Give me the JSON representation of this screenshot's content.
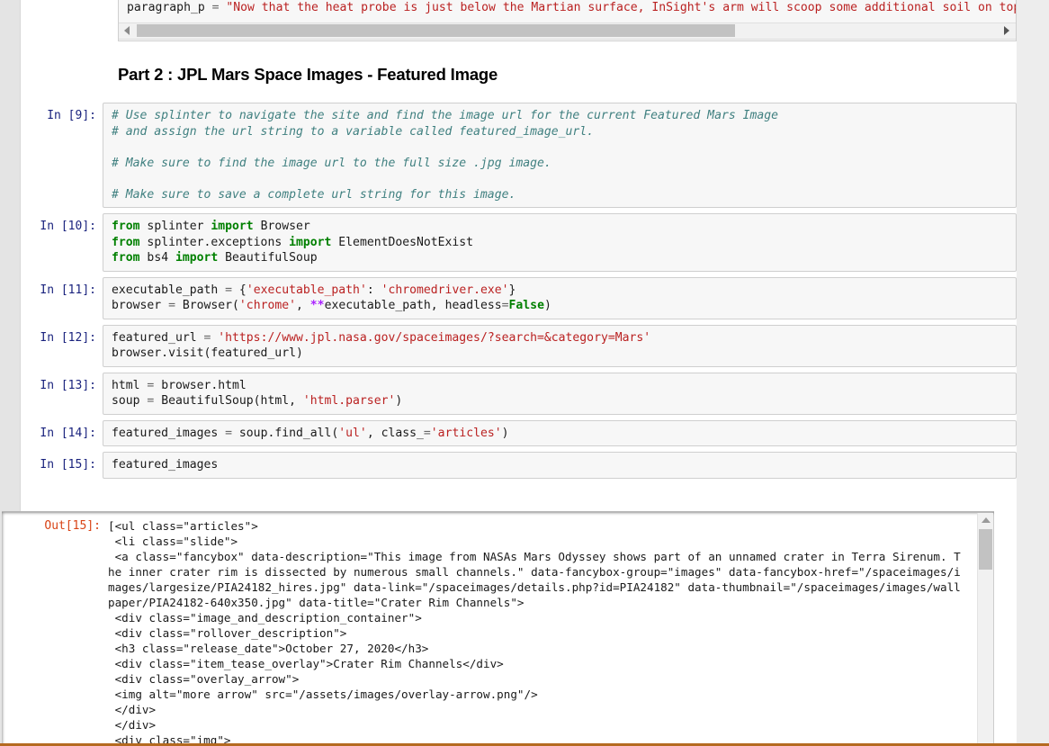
{
  "window": {
    "accent_orange": "#b56a20",
    "page_bg": "#ffffff",
    "cell_bg": "#f7f7f7"
  },
  "top_cell": {
    "prompt": "",
    "partial_line_above": "",
    "code_line": "paragraph_p = \"Now that the heat probe is just below the Martian surface, InSight's arm will scoop some additional soil on top to",
    "scrollbar": {
      "name": "horizontal-scrollbar",
      "left_arrow": "◀",
      "right_arrow": "▶"
    }
  },
  "heading": {
    "text": "Part 2 : JPL Mars Space Images - Featured Image"
  },
  "cells": [
    {
      "prompt": "In [9]:",
      "id": "cell-9",
      "lines": [
        [
          {
            "t": "# Use splinter to navigate the site and find the image url for the current Featured Mars Image",
            "c": "c"
          }
        ],
        [
          {
            "t": "# and assign the url string to a variable called featured_image_url.",
            "c": "c"
          }
        ],
        [
          {
            "t": "",
            "c": "n"
          }
        ],
        [
          {
            "t": "# Make sure to find the image url to the full size .jpg image.",
            "c": "c"
          }
        ],
        [
          {
            "t": "",
            "c": "n"
          }
        ],
        [
          {
            "t": "# Make sure to save a complete url string for this image.",
            "c": "c"
          }
        ]
      ]
    },
    {
      "prompt": "In [10]:",
      "id": "cell-10",
      "lines": [
        [
          {
            "t": "from",
            "c": "k"
          },
          {
            "t": " splinter ",
            "c": "n"
          },
          {
            "t": "import",
            "c": "k"
          },
          {
            "t": " Browser",
            "c": "n"
          }
        ],
        [
          {
            "t": "from",
            "c": "k"
          },
          {
            "t": " splinter.exceptions ",
            "c": "n"
          },
          {
            "t": "import",
            "c": "k"
          },
          {
            "t": " ElementDoesNotExist",
            "c": "n"
          }
        ],
        [
          {
            "t": "from",
            "c": "k"
          },
          {
            "t": " bs4 ",
            "c": "n"
          },
          {
            "t": "import",
            "c": "k"
          },
          {
            "t": " BeautifulSoup",
            "c": "n"
          }
        ]
      ]
    },
    {
      "prompt": "In [11]:",
      "id": "cell-11",
      "lines": [
        [
          {
            "t": "executable_path ",
            "c": "n"
          },
          {
            "t": "=",
            "c": "o"
          },
          {
            "t": " {",
            "c": "n"
          },
          {
            "t": "'executable_path'",
            "c": "s"
          },
          {
            "t": ": ",
            "c": "n"
          },
          {
            "t": "'chromedriver.exe'",
            "c": "s"
          },
          {
            "t": "}",
            "c": "n"
          }
        ],
        [
          {
            "t": "browser ",
            "c": "n"
          },
          {
            "t": "=",
            "c": "o"
          },
          {
            "t": " Browser(",
            "c": "n"
          },
          {
            "t": "'chrome'",
            "c": "s"
          },
          {
            "t": ", ",
            "c": "n"
          },
          {
            "t": "**",
            "c": "op"
          },
          {
            "t": "executable_path, headless",
            "c": "n"
          },
          {
            "t": "=",
            "c": "o"
          },
          {
            "t": "False",
            "c": "nb"
          },
          {
            "t": ")",
            "c": "n"
          }
        ]
      ]
    },
    {
      "prompt": "In [12]:",
      "id": "cell-12",
      "lines": [
        [
          {
            "t": "featured_url ",
            "c": "n"
          },
          {
            "t": "=",
            "c": "o"
          },
          {
            "t": " ",
            "c": "n"
          },
          {
            "t": "'https://www.jpl.nasa.gov/spaceimages/?search=&category=Mars'",
            "c": "s"
          }
        ],
        [
          {
            "t": "browser.visit(featured_url)",
            "c": "n"
          }
        ]
      ]
    },
    {
      "prompt": "In [13]:",
      "id": "cell-13",
      "lines": [
        [
          {
            "t": "html ",
            "c": "n"
          },
          {
            "t": "=",
            "c": "o"
          },
          {
            "t": " browser.html",
            "c": "n"
          }
        ],
        [
          {
            "t": "soup ",
            "c": "n"
          },
          {
            "t": "=",
            "c": "o"
          },
          {
            "t": " BeautifulSoup(html, ",
            "c": "n"
          },
          {
            "t": "'html.parser'",
            "c": "s"
          },
          {
            "t": ")",
            "c": "n"
          }
        ]
      ]
    },
    {
      "prompt": "In [14]:",
      "id": "cell-14",
      "lines": [
        [
          {
            "t": "featured_images ",
            "c": "n"
          },
          {
            "t": "=",
            "c": "o"
          },
          {
            "t": " soup.find_all(",
            "c": "n"
          },
          {
            "t": "'ul'",
            "c": "s"
          },
          {
            "t": ", class_",
            "c": "n"
          },
          {
            "t": "=",
            "c": "o"
          },
          {
            "t": "'articles'",
            "c": "s"
          },
          {
            "t": ")",
            "c": "n"
          }
        ]
      ]
    },
    {
      "prompt": "In [15]:",
      "id": "cell-15",
      "lines": [
        [
          {
            "t": "featured_images",
            "c": "n"
          }
        ]
      ]
    }
  ],
  "output": {
    "prompt": "Out[15]:",
    "text": "[<ul class=\"articles\">\n <li class=\"slide\">\n <a class=\"fancybox\" data-description=\"This image from NASAs Mars Odyssey shows part of an unnamed crater in Terra Sirenum. T\nhe inner crater rim is dissected by numerous small channels.\" data-fancybox-group=\"images\" data-fancybox-href=\"/spaceimages/i\nmages/largesize/PIA24182_hires.jpg\" data-link=\"/spaceimages/details.php?id=PIA24182\" data-thumbnail=\"/spaceimages/images/wall\npaper/PIA24182-640x350.jpg\" data-title=\"Crater Rim Channels\">\n <div class=\"image_and_description_container\">\n <div class=\"rollover_description\">\n <h3 class=\"release_date\">October 27, 2020</h3>\n <div class=\"item_tease_overlay\">Crater Rim Channels</div>\n <div class=\"overlay_arrow\">\n <img alt=\"more arrow\" src=\"/assets/images/overlay-arrow.png\"/>\n </div>\n </div>\n <div class=\"img\">",
    "scrollbar": {
      "name": "output-vertical-scrollbar",
      "up_arrow": "▲"
    }
  }
}
